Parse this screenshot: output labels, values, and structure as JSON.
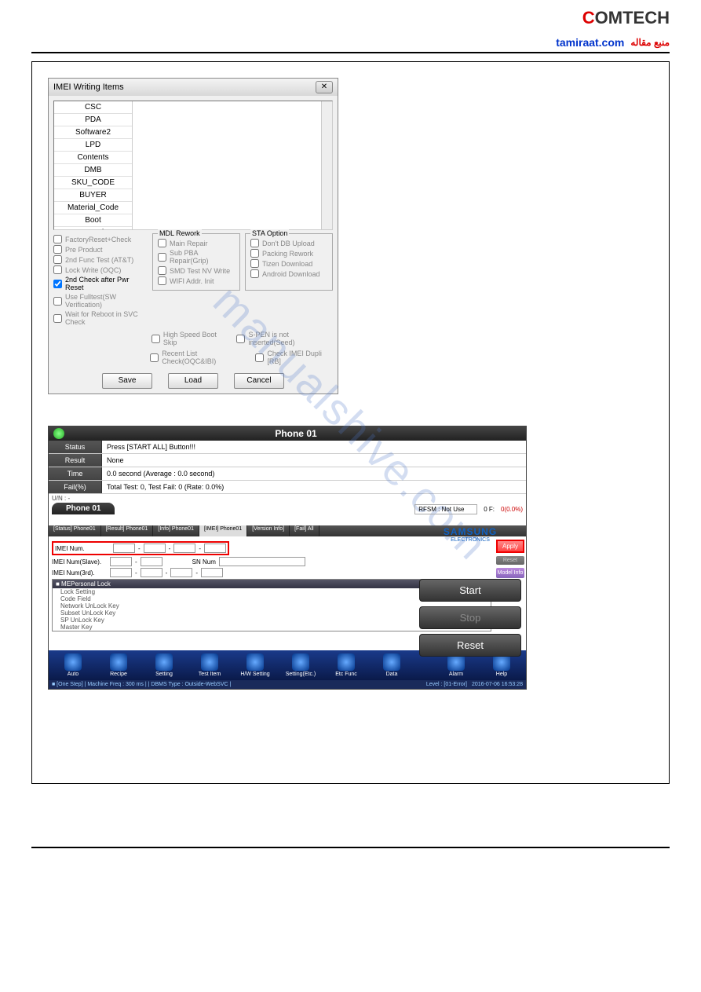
{
  "header": {
    "logo_c": "C",
    "logo_rest": "OMTECH",
    "tamiraat": "tamiraat.com",
    "ar": "منبع مقاله"
  },
  "watermark": "manualshive.com",
  "dialog1": {
    "title": "IMEI Writing Items",
    "close": "✕",
    "list": [
      "CSC",
      "PDA",
      "Software2",
      "LPD",
      "Contents",
      "DMB",
      "SKU_CODE",
      "BUYER",
      "Material_Code",
      "Boot",
      "Factory Software"
    ],
    "leftchks": [
      {
        "label": "FactoryReset+Check",
        "on": false
      },
      {
        "label": "Pre Product",
        "on": false
      },
      {
        "label": "2nd Func Test (AT&T)",
        "on": false
      },
      {
        "label": "Lock Write (OQC)",
        "on": false
      },
      {
        "label": "2nd Check after Pwr Reset",
        "on": true
      },
      {
        "label": "Use Fulltest(SW Verification)",
        "on": false
      },
      {
        "label": "Wait for Reboot in SVC Check",
        "on": false
      }
    ],
    "mdl_label": "MDL Rework",
    "mdl": [
      "Main Repair",
      "Sub PBA Repair(Grip)",
      "SMD Test NV Write",
      "WIFI Addr. Init"
    ],
    "sta_label": "STA Option",
    "sta": [
      "Don't DB Upload",
      "Packing Rework",
      "Tizen Download",
      "Android Download"
    ],
    "extra1": "High Speed Boot Skip",
    "extra2": "S-PEN is not inserted(Seed)",
    "extra3": "Recent List Check(OQC&IBI)",
    "extra4": "Check IMEI Dupli [RB]",
    "save": "Save",
    "load": "Load",
    "cancel": "Cancel"
  },
  "shot2": {
    "title": "Phone 01",
    "rows": [
      {
        "label": "Status",
        "val": "Press [START ALL] Button!!!"
      },
      {
        "label": "Result",
        "val": "None"
      },
      {
        "label": "Time",
        "val": "0.0 second (Average : 0.0 second)"
      },
      {
        "label": "Fail(%)",
        "val": "Total Test: 0, Test Fail: 0 (Rate: 0.0%)"
      }
    ],
    "uin": "U/N : -",
    "tab": "Phone 01",
    "rfsm": "RFSM : Not Use",
    "f_label": "0 F:",
    "f_val": "0(0.0%)",
    "subtabs": [
      "[Status] Phone01",
      "[Result] Phone01",
      "[Info] Phone01",
      "[IMEI] Phone01",
      "[Version Info]",
      "[Fail] All"
    ],
    "imei_lbl": "IMEI Num.",
    "imei_slave_lbl": "IMEI Num(Slave).",
    "sn_lbl": "SN Num",
    "imei_3rd_lbl": "IMEI Num(3rd).",
    "lockhdr": "■ MEPersonal Lock",
    "locks": [
      "Lock Setting",
      "Code Field",
      "Network UnLock Key",
      "Subset UnLock Key",
      "SP UnLock Key",
      "Master Key"
    ],
    "apply": "Apply",
    "reset_sm": "Reset",
    "modelinfo": "Model Info",
    "samsung": "SAMSUNG",
    "samsung_sub": "ELECTRONICS",
    "start": "Start",
    "stop": "Stop",
    "reset": "Reset",
    "tools": [
      "Auto",
      "Recipe",
      "Setting",
      "Test Item",
      "H/W Setting",
      "Setting(Etc.)",
      "Etc Func",
      "Data",
      "",
      "Alarm",
      "Help"
    ],
    "status_left": "■ [One Step]   | Machine Freq : 300 ms |   | DBMS Type : Outside-WebSVC |",
    "status_level": "Level :  [01-Error]",
    "status_time": "2016-07-06 16:53:28"
  }
}
